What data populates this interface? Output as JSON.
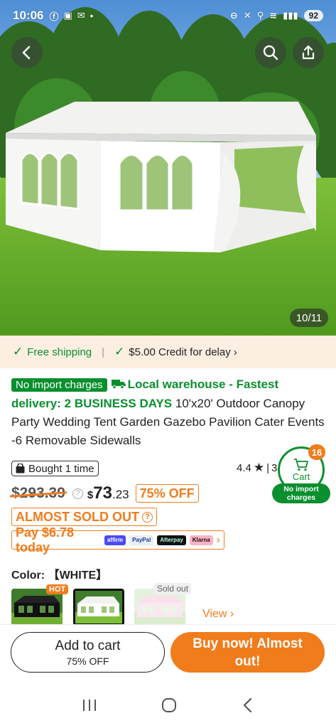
{
  "status_bar": {
    "time": "10:06",
    "battery": "92",
    "network": "6"
  },
  "image_counter": "10/11",
  "shipping": {
    "free_label": "Free shipping",
    "credit_label": "$5.00 Credit for delay"
  },
  "title": {
    "badge": "No import charges",
    "local_warehouse": "Local warehouse - Fastest delivery: 2 BUSINESS DAYS",
    "product_name": "10'x20' Outdoor Canopy Party Wedding Tent Garden Gazebo Pavilion Cater Events -6 Removable Sidewalls"
  },
  "bought": "Bought 1 time",
  "rating": {
    "score": "4.4",
    "extra": "3"
  },
  "cart": {
    "count": "16",
    "label": "Cart",
    "no_import": "No import charges"
  },
  "price": {
    "old": "$293.39",
    "currency": "$",
    "whole": "73",
    "cents": ".23",
    "off": "75% OFF"
  },
  "sold_out_label": "ALMOST SOLD OUT",
  "pay": {
    "text": "Pay $6.78 today",
    "logos": [
      "affirm",
      "PayPal",
      "Afterpay",
      "Klarna"
    ]
  },
  "color": {
    "label": "Color:",
    "value": "【WHITE】",
    "hot": "HOT",
    "sold_out": "Sold out",
    "view": "View"
  },
  "buttons": {
    "add_to_cart": "Add to cart",
    "add_to_cart_sub": "75% OFF",
    "buy_now": "Buy now! Almost out!"
  },
  "colors": {
    "accent": "#f07c1c",
    "green": "#0a8f2e",
    "shipping_band": "#fcefe2"
  }
}
